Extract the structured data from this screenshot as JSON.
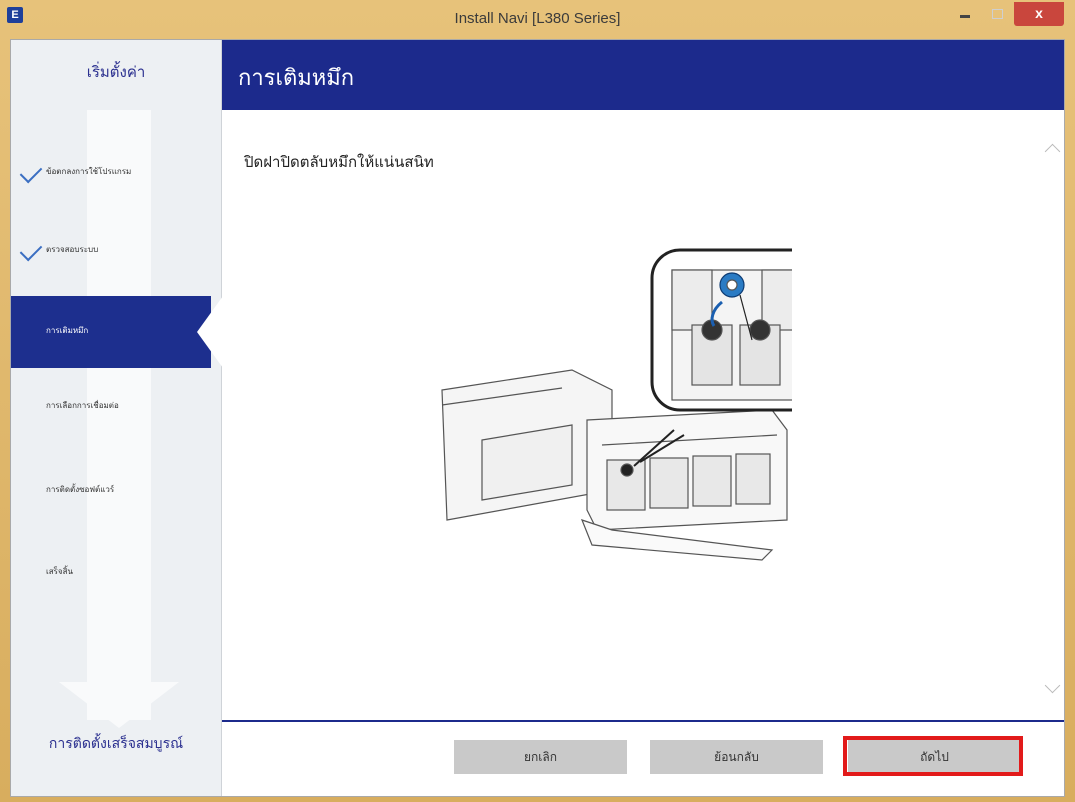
{
  "window": {
    "icon_letter": "E",
    "title": "Install Navi [L380 Series]",
    "close_label": "x"
  },
  "sidebar": {
    "top_label": "เริ่มตั้งค่า",
    "steps": [
      {
        "label": "ข้อตกลงการใช้โปรแกรม",
        "state": "done"
      },
      {
        "label": "ตรวจสอบระบบ",
        "state": "done"
      },
      {
        "label": "การเติมหมึก",
        "state": "active"
      },
      {
        "label": "การเลือกการเชื่อมต่อ",
        "state": "pending"
      },
      {
        "label": "การติดตั้งซอฟต์แวร์",
        "state": "pending"
      },
      {
        "label": "เสร็จสิ้น",
        "state": "pending"
      }
    ],
    "bottom_label": "การติดตั้งเสร็จสมบูรณ์"
  },
  "header": {
    "title": "การเติมหมึก"
  },
  "content": {
    "instruction": "ปิดฝาปิดตลับหมึกให้แน่นสนิท"
  },
  "footer": {
    "cancel_label": "ยกเลิก",
    "back_label": "ย้อนกลับ",
    "next_label": "ถัดไป"
  },
  "colors": {
    "header_blue": "#1c2a8c",
    "highlight_red": "#e21a1a",
    "button_gray": "#c9c9c9"
  }
}
